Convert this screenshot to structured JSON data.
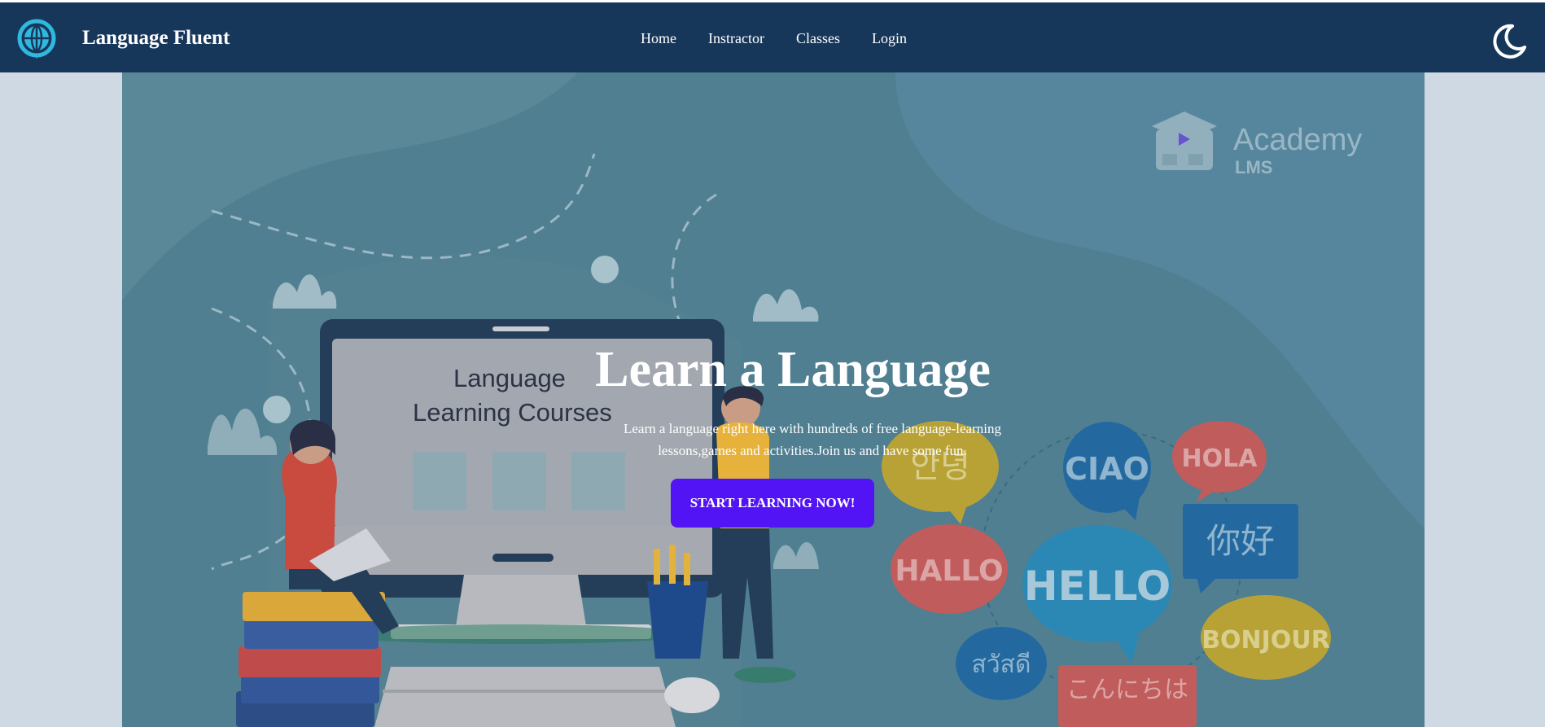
{
  "brand": {
    "name": "Language Fluent",
    "logo_icon": "globe-icon"
  },
  "nav": {
    "items": [
      {
        "label": "Home"
      },
      {
        "label": "Instractor"
      },
      {
        "label": "Classes"
      },
      {
        "label": "Login"
      }
    ],
    "theme_icon": "moon-icon"
  },
  "hero": {
    "title": "Learn a Language",
    "subtitle_line1": "Learn a language right here with hundreds of free language-learning",
    "subtitle_line2": "lessons,games and activities.Join us and have some fun.",
    "cta_label": "START LEARNING NOW!",
    "watermark": {
      "line1": "Academy",
      "line2": "LMS"
    },
    "monitor_text": {
      "line1": "Language",
      "line2": "Learning Courses"
    },
    "bubbles": [
      "안녕",
      "CIAO",
      "HOLA",
      "你好",
      "HALLO",
      "HELLO",
      "BONJOUR",
      "สวัสดี",
      "こんにちは"
    ]
  },
  "colors": {
    "navbar": "#17375a",
    "page_bg": "#cfd9e4",
    "hero_bg": "#507f91",
    "cta": "#5314f5"
  }
}
